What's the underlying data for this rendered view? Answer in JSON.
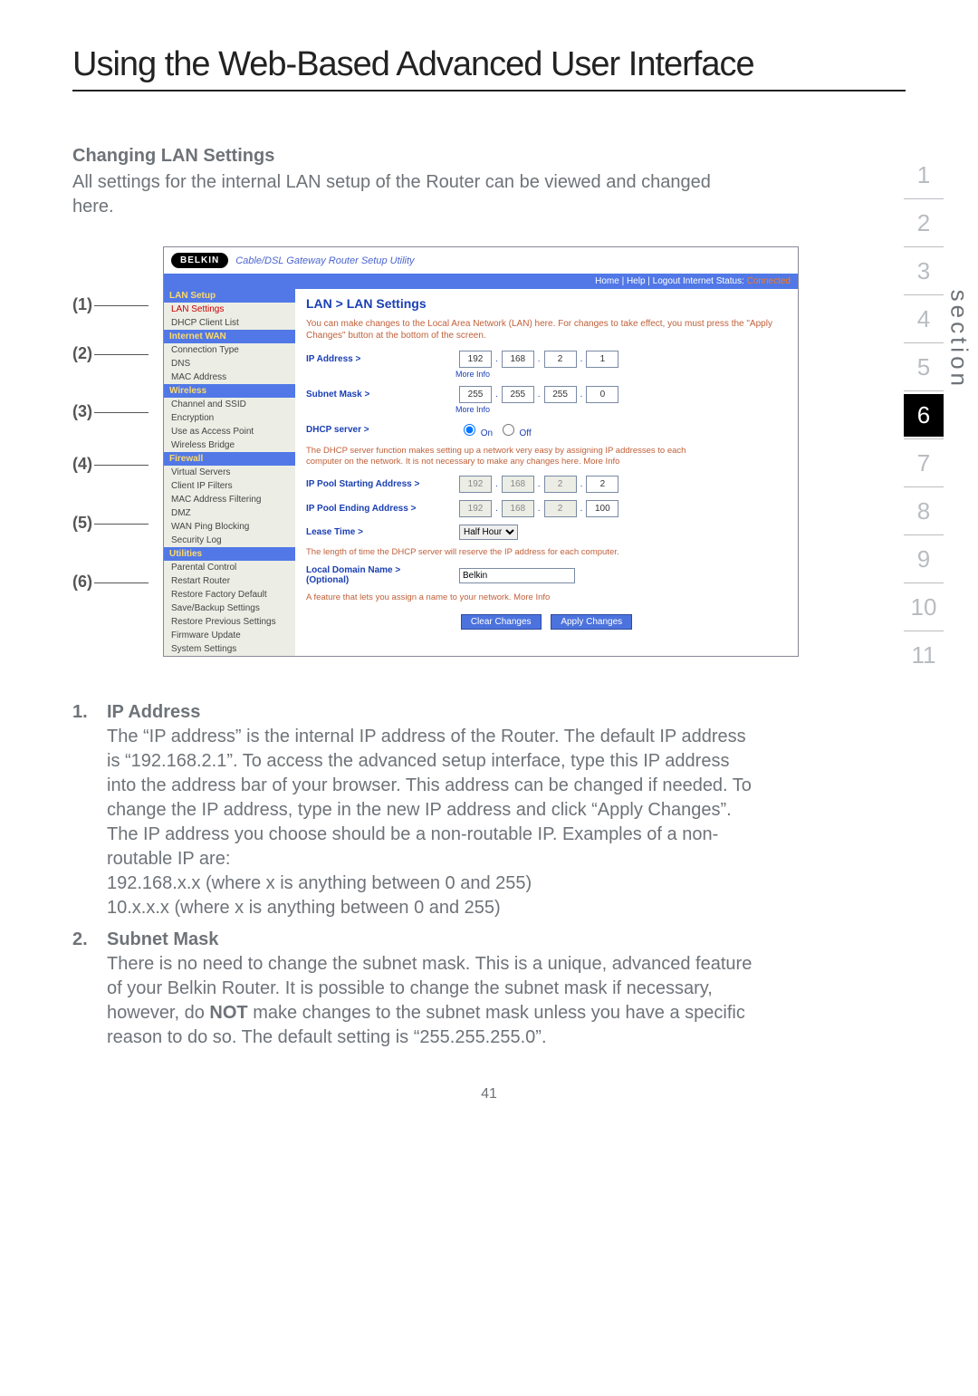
{
  "page": {
    "title": "Using the Web-Based Advanced User Interface",
    "number": "41"
  },
  "section": {
    "heading": "Changing LAN Settings",
    "intro": "All settings for the internal LAN setup of the Router can be viewed and changed here."
  },
  "callouts": {
    "c1": "(1)",
    "c2": "(2)",
    "c3": "(3)",
    "c4": "(4)",
    "c5": "(5)",
    "c6": "(6)"
  },
  "router": {
    "logo": "BELKIN",
    "subtitle": "Cable/DSL Gateway Router Setup Utility",
    "topbar": "Home | Help | Logout    Internet Status: ",
    "topbar_status": "Connected",
    "nav": {
      "lan_setup_head": "LAN Setup",
      "lan_settings": "LAN Settings",
      "dhcp_client_list": "DHCP Client List",
      "internet_wan_head": "Internet WAN",
      "connection_type": "Connection Type",
      "dns": "DNS",
      "mac_address": "MAC Address",
      "wireless_head": "Wireless",
      "channel_ssid": "Channel and SSID",
      "encryption": "Encryption",
      "use_ap": "Use as Access Point",
      "wireless_bridge": "Wireless Bridge",
      "firewall_head": "Firewall",
      "virtual_servers": "Virtual Servers",
      "client_ip_filters": "Client IP Filters",
      "mac_filtering": "MAC Address Filtering",
      "dmz": "DMZ",
      "wan_ping": "WAN Ping Blocking",
      "security_log": "Security Log",
      "utilities_head": "Utilities",
      "parental_control": "Parental Control",
      "restart_router": "Restart Router",
      "restore_factory": "Restore Factory Default",
      "save_backup": "Save/Backup Settings",
      "restore_previous": "Restore Previous Settings",
      "firmware_update": "Firmware Update",
      "system_settings": "System Settings"
    },
    "main": {
      "title": "LAN > LAN Settings",
      "desc": "You can make changes to the Local Area Network (LAN) here. For changes to take effect, you must press the \"Apply Changes\" button at the bottom of the screen.",
      "ip_label": "IP Address >",
      "ip_more": "More Info",
      "ip": [
        "192",
        "168",
        "2",
        "1"
      ],
      "subnet_label": "Subnet Mask >",
      "subnet_more": "More Info",
      "subnet": [
        "255",
        "255",
        "255",
        "0"
      ],
      "dhcp_label": "DHCP server >",
      "dhcp_on": "On",
      "dhcp_off": "Off",
      "dhcp_note": "The DHCP server function makes setting up a network very easy by assigning IP addresses to each computer on the network. It is not necessary to make any changes here. More Info",
      "pool_start_label": "IP Pool Starting Address >",
      "pool_start": [
        "192",
        "168",
        "2",
        "2"
      ],
      "pool_end_label": "IP Pool Ending Address >",
      "pool_end": [
        "192",
        "168",
        "2",
        "100"
      ],
      "lease_label": "Lease Time >",
      "lease_value": "Half Hour",
      "lease_note": "The length of time the DHCP server will reserve the IP address for each computer.",
      "domain_label_a": "Local Domain Name >",
      "domain_label_b": "(Optional)",
      "domain_value": "Belkin",
      "domain_note": "A feature that lets you assign a name to your network. More Info",
      "btn_clear": "Clear Changes",
      "btn_apply": "Apply Changes"
    }
  },
  "body": {
    "item1_num": "1.",
    "item1_head": "IP Address",
    "item1_text": "The “IP address” is the internal IP address of the Router. The default IP address is “192.168.2.1”. To access the advanced setup interface, type this IP address into the address bar of your browser. This address can be changed if needed. To change the IP address, type in the new IP address and click “Apply Changes”. The IP address you choose should be a non-routable IP. Examples of a non-routable IP are:",
    "item1_ex1": "192.168.x.x (where x is anything between 0 and 255)",
    "item1_ex2": "10.x.x.x (where x is anything between 0 and 255)",
    "item2_num": "2.",
    "item2_head": "Subnet Mask",
    "item2_text_a": "There is no need to change the subnet mask. This is a unique, advanced feature of your Belkin Router. It is possible to change the subnet mask if necessary, however, do ",
    "item2_not": "NOT",
    "item2_text_b": " make changes to the subnet mask unless you have a specific reason to do so. The default setting is “255.255.255.0”."
  },
  "sidebar": {
    "label": "section",
    "items": [
      "1",
      "2",
      "3",
      "4",
      "5",
      "6",
      "7",
      "8",
      "9",
      "10",
      "11"
    ],
    "active": "6"
  }
}
